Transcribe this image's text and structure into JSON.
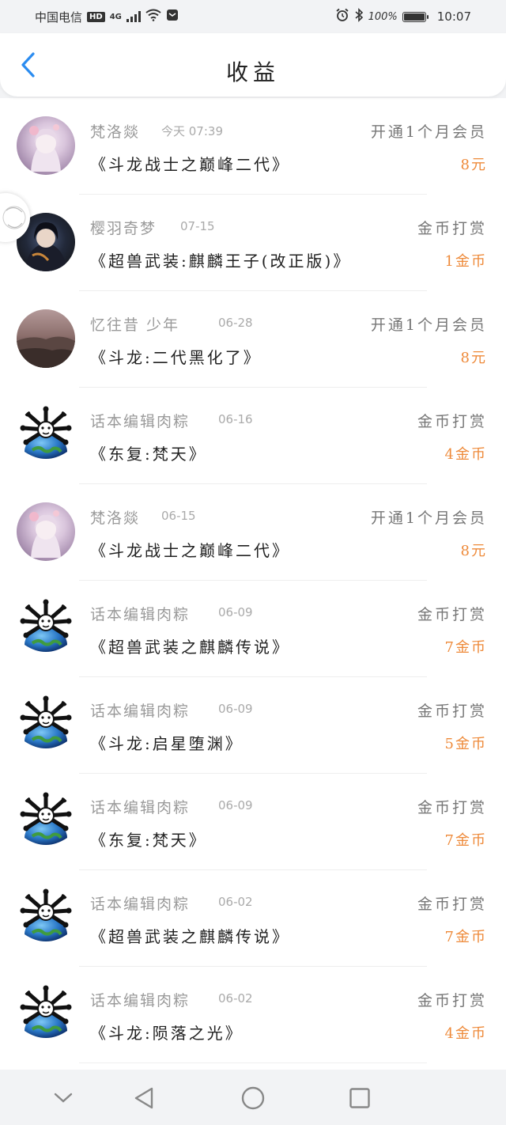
{
  "status_bar": {
    "carrier": "中国电信",
    "hd": "HD",
    "network": "4G",
    "battery": "100%",
    "battery_level": 1.0,
    "time": "10:07"
  },
  "header": {
    "title": "收益",
    "back_icon": "chevron-left-icon",
    "accent_color": "#2b8cf0"
  },
  "colors": {
    "amount": "#ee8a3a",
    "name": "#9a9a9a",
    "book": "#222222"
  },
  "records": [
    {
      "name": "梵洛燚",
      "date": "今天 07:39",
      "type": "开通1个月会员",
      "book": "《斗龙战士之巅峰二代》",
      "amount": "8元",
      "avatar": "anime-girl-avatar"
    },
    {
      "name": "樱羽奇梦",
      "date": "07-15",
      "type": "金币打赏",
      "book": "《超兽武装:麒麟王子(改正版)》",
      "amount": "1金币",
      "avatar": "dark-anime-avatar"
    },
    {
      "name": "忆往昔 少年",
      "date": "06-28",
      "type": "开通1个月会员",
      "book": "《斗龙:二代黑化了》",
      "amount": "8元",
      "avatar": "sunset-avatar"
    },
    {
      "name": "话本编辑肉粽",
      "date": "06-16",
      "type": "金币打赏",
      "book": "《东复:梵天》",
      "amount": "4金币",
      "avatar": "earth-spider-avatar"
    },
    {
      "name": "梵洛燚",
      "date": "06-15",
      "type": "开通1个月会员",
      "book": "《斗龙战士之巅峰二代》",
      "amount": "8元",
      "avatar": "anime-girl-avatar"
    },
    {
      "name": "话本编辑肉粽",
      "date": "06-09",
      "type": "金币打赏",
      "book": "《超兽武装之麒麟传说》",
      "amount": "7金币",
      "avatar": "earth-spider-avatar"
    },
    {
      "name": "话本编辑肉粽",
      "date": "06-09",
      "type": "金币打赏",
      "book": "《斗龙:启星堕渊》",
      "amount": "5金币",
      "avatar": "earth-spider-avatar"
    },
    {
      "name": "话本编辑肉粽",
      "date": "06-09",
      "type": "金币打赏",
      "book": "《东复:梵天》",
      "amount": "7金币",
      "avatar": "earth-spider-avatar"
    },
    {
      "name": "话本编辑肉粽",
      "date": "06-02",
      "type": "金币打赏",
      "book": "《超兽武装之麒麟传说》",
      "amount": "7金币",
      "avatar": "earth-spider-avatar"
    },
    {
      "name": "话本编辑肉粽",
      "date": "06-02",
      "type": "金币打赏",
      "book": "《斗龙:陨落之光》",
      "amount": "4金币",
      "avatar": "earth-spider-avatar"
    }
  ],
  "nav_bar": {
    "buttons": [
      "chevron-down-icon",
      "back-triangle-icon",
      "home-circle-icon",
      "recent-square-icon"
    ]
  }
}
